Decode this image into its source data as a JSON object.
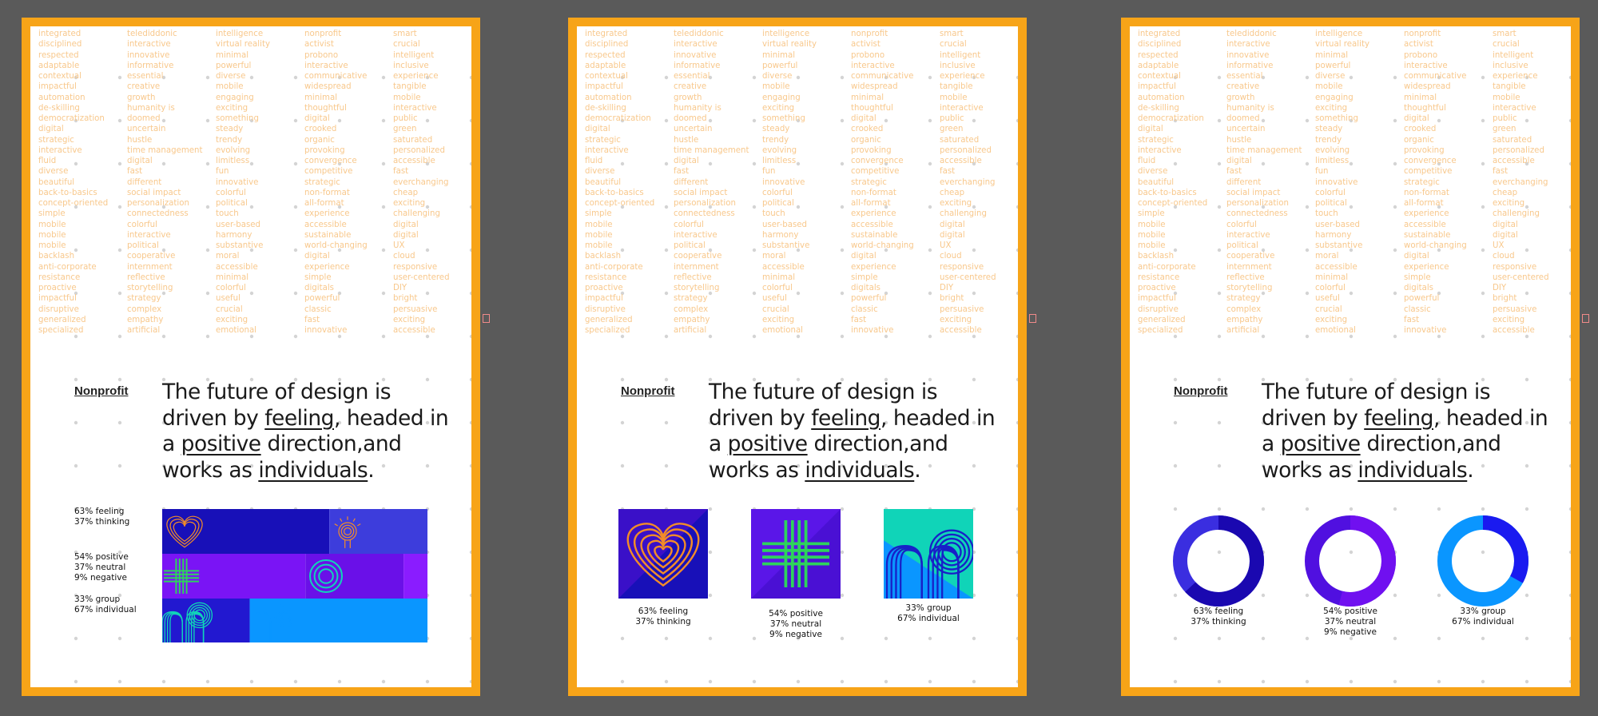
{
  "words": {
    "col1": [
      "integrated",
      "disciplined",
      "respected",
      "adaptable",
      "contextual",
      "impactful",
      "automation",
      "de-skilling",
      "democratization",
      "digital",
      "strategic",
      "interactive",
      "fluid",
      "diverse",
      "beautiful",
      "back-to-basics",
      "concept-oriented",
      "simple",
      "mobile",
      "mobile",
      "mobile",
      "backlash",
      "anti-corporate",
      "resistance",
      "proactive",
      "impactful",
      "disruptive",
      "generalized",
      "specialized"
    ],
    "col2": [
      "telediddonic",
      "interactive",
      "innovative",
      "informative",
      "essential",
      "creative",
      "growth",
      "humanity is",
      "doomed",
      "uncertain",
      "hustle",
      "time management",
      "digital",
      "fast",
      "different",
      "social impact",
      "personalization",
      "connectedness",
      "colorful",
      "interactive",
      "political",
      "cooperative",
      "internment",
      "reflective",
      "storytelling",
      "strategy",
      "complex",
      "empathy",
      "artificial"
    ],
    "col3": [
      "intelligence",
      "virtual reality",
      "minimal",
      "powerful",
      "diverse",
      "mobile",
      "engaging",
      "exciting",
      "something",
      "steady",
      "trendy",
      "evolving",
      "limitless",
      "fun",
      "innovative",
      "colorful",
      "political",
      "touch",
      "user-based",
      "harmony",
      "substantive",
      "moral",
      "accessible",
      "minimal",
      "colorful",
      "useful",
      "crucial",
      "exciting",
      "emotional"
    ],
    "col4": [
      "nonprofit",
      "activist",
      "probono",
      "interactive",
      "communicative",
      "widespread",
      "minimal",
      "thoughtful",
      "digital",
      "crooked",
      "organic",
      "provoking",
      "convergence",
      "competitive",
      "strategic",
      "non-format",
      "all-format",
      "experience",
      "accessible",
      "sustainable",
      "world-changing",
      "digital",
      "experience",
      "simple",
      "digitals",
      "powerful",
      "classic",
      "fast",
      "innovative"
    ],
    "col5": [
      "smart",
      "crucial",
      "intelligent",
      "inclusive",
      "experience",
      "tangible",
      "mobile",
      "interactive",
      "public",
      "green",
      "saturated",
      "personalized",
      "accessible",
      "fast",
      "everchanging",
      "cheap",
      "exciting",
      "challenging",
      "digital",
      "digital",
      "UX",
      "cloud",
      "responsive",
      "user-centered",
      "DIY",
      "bright",
      "persuasive",
      "exciting",
      "accessible"
    ]
  },
  "category": "Nonprofit",
  "headline": {
    "p1": "The future of design is driven by ",
    "w1": "feeling",
    "p2": ", headed in a ",
    "w2": "positive",
    "p3": " direction,and works as ",
    "w3": "individuals",
    "p4": "."
  },
  "stats": {
    "feeling": [
      "63% feeling",
      "37% thinking"
    ],
    "positive": [
      "54% positive",
      "37% neutral",
      "9% negative"
    ],
    "group": [
      "33% group",
      "67% individual"
    ]
  },
  "values": {
    "feeling": 0.63,
    "positive": 0.54,
    "neutral": 0.37,
    "negative": 0.09,
    "group": 0.33
  },
  "colors": {
    "artboard_border": "#f7a418",
    "word_grid": "#f8c88c",
    "navy": "#1810b8",
    "violet": "#7a14f5",
    "sky": "#0a96ff",
    "orange": "#f28c28",
    "green": "#2ed35c",
    "teal": "#10d4b8"
  }
}
